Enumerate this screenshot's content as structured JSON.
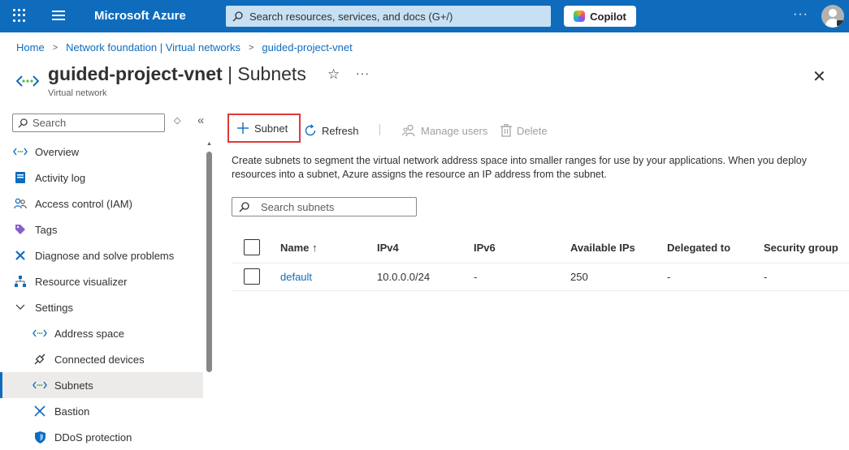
{
  "topbar": {
    "brand": "Microsoft Azure",
    "search_placeholder": "Search resources, services, and docs (G+/)",
    "copilot_label": "Copilot",
    "more": "···"
  },
  "breadcrumb": [
    "Home",
    "Network foundation | Virtual networks",
    "guided-project-vnet"
  ],
  "header": {
    "resource_name": "guided-project-vnet",
    "page_name": "| Subnets",
    "subtitle": "Virtual network",
    "favorite_glyph": "☆",
    "more": "···",
    "close": "✕"
  },
  "nav": {
    "search_placeholder": "Search",
    "items": [
      {
        "label": "Overview",
        "icon": "vnet-icon",
        "level": 0
      },
      {
        "label": "Activity log",
        "icon": "activity-log-icon",
        "level": 0
      },
      {
        "label": "Access control (IAM)",
        "icon": "people-icon",
        "level": 0
      },
      {
        "label": "Tags",
        "icon": "tag-icon",
        "level": 0
      },
      {
        "label": "Diagnose and solve problems",
        "icon": "wrench-icon",
        "level": 0
      },
      {
        "label": "Resource visualizer",
        "icon": "hierarchy-icon",
        "level": 0
      },
      {
        "label": "Settings",
        "icon": "chevron-down-icon",
        "level": 0
      },
      {
        "label": "Address space",
        "icon": "vnet-icon",
        "level": 1
      },
      {
        "label": "Connected devices",
        "icon": "plug-icon",
        "level": 1
      },
      {
        "label": "Subnets",
        "icon": "vnet-icon",
        "level": 1,
        "active": true
      },
      {
        "label": "Bastion",
        "icon": "bastion-icon",
        "level": 1
      },
      {
        "label": "DDoS protection",
        "icon": "shield-icon",
        "level": 1
      }
    ]
  },
  "toolbar": {
    "add_subnet": "Subnet",
    "refresh": "Refresh",
    "manage_users": "Manage users",
    "delete": "Delete"
  },
  "description": "Create subnets to segment the virtual network address space into smaller ranges for use by your applications. When you deploy resources into a subnet, Azure assigns the resource an IP address from the subnet.",
  "subnet_search_placeholder": "Search subnets",
  "table": {
    "columns": [
      "Name ↑",
      "IPv4",
      "IPv6",
      "Available IPs",
      "Delegated to",
      "Security group"
    ],
    "rows": [
      [
        "default",
        "10.0.0.0/24",
        "-",
        "250",
        "-",
        "-"
      ]
    ]
  },
  "colors": {
    "topbar": "#0f6cbd",
    "link": "#0f6cbd",
    "highlight_box": "#e23838"
  }
}
